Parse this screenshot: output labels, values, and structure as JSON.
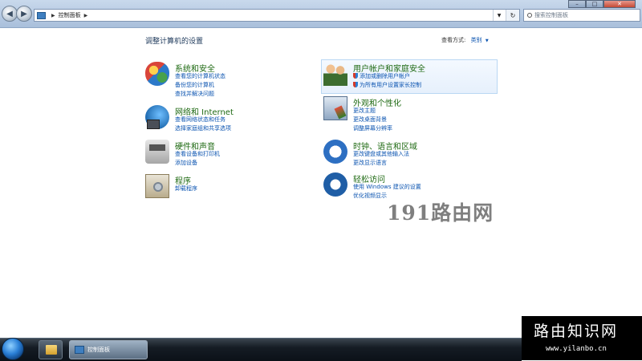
{
  "window": {
    "breadcrumb": [
      "控制面板"
    ],
    "search_placeholder": "搜索控制面板"
  },
  "header": {
    "title": "调整计算机的设置",
    "view_by_label": "查看方式:",
    "view_by_value": "类别"
  },
  "categories": [
    {
      "title": "系统和安全",
      "links": [
        "查看您的计算机状态",
        "备份您的计算机",
        "查找并解决问题"
      ]
    },
    {
      "title": "网络和 Internet",
      "links": [
        "查看网络状态和任务",
        "选择家庭组和共享选项"
      ]
    },
    {
      "title": "硬件和声音",
      "links": [
        "查看设备和打印机",
        "添加设备"
      ]
    },
    {
      "title": "程序",
      "links": [
        "卸载程序"
      ]
    },
    {
      "title": "用户帐户和家庭安全",
      "links": [
        "添加或删除用户帐户",
        "为所有用户设置家长控制"
      ]
    },
    {
      "title": "外观和个性化",
      "links": [
        "更改主题",
        "更改桌面背景",
        "调整屏幕分辨率"
      ]
    },
    {
      "title": "时钟、语言和区域",
      "links": [
        "更改键盘或其他输入法",
        "更改显示语言"
      ]
    },
    {
      "title": "轻松访问",
      "links": [
        "使用 Windows 建议的设置",
        "优化视频显示"
      ]
    }
  ],
  "taskbar": {
    "active_window": "控制面板"
  },
  "watermarks": {
    "center": "191路由网",
    "corner_title": "路由知识网",
    "corner_url": "www.yilanbo.cn"
  }
}
